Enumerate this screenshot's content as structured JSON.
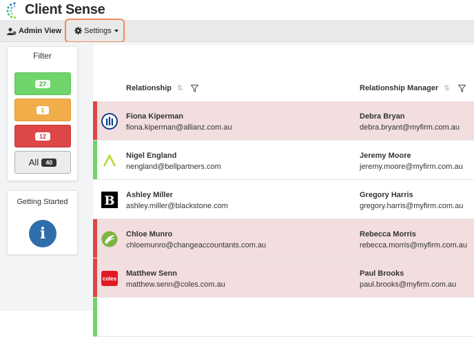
{
  "brand": {
    "name": "Client Sense"
  },
  "nav": {
    "admin_label": "Admin View",
    "settings_label": "Settings"
  },
  "filter": {
    "title": "Filter",
    "green_count": "27",
    "amber_count": "1",
    "red_count": "12",
    "all_label": "All",
    "all_count": "40"
  },
  "getting_started": {
    "title": "Getting Started"
  },
  "table": {
    "headers": {
      "relationship": "Relationship",
      "manager": "Relationship Manager"
    },
    "rows": [
      {
        "name": "Fiona Kiperman",
        "email": "fiona.kiperman@allianz.com.au",
        "manager": "Debra Bryan",
        "manager_email": "debra.bryant@myfirm.com.au",
        "status": "red",
        "logo": "allianz-logo-icon"
      },
      {
        "name": "Nigel England",
        "email": "nengland@bellpartners.com",
        "manager": "Jeremy Moore",
        "manager_email": "jeremy.moore@myfirm.com.au",
        "status": "green",
        "logo": "bell-partners-logo-icon"
      },
      {
        "name": "Ashley Miller",
        "email": "ashley.miller@blackstone.com",
        "manager": "Gregory Harris",
        "manager_email": "gregory.harris@myfirm.com.au",
        "status": "none",
        "logo": "blackstone-logo-icon"
      },
      {
        "name": "Chloe Munro",
        "email": "chloemunro@changeaccountants.com.au",
        "manager": "Rebecca Morris",
        "manager_email": "rebecca.morris@myfirm.com.au",
        "status": "red",
        "logo": "change-accountants-logo-icon"
      },
      {
        "name": "Matthew Senn",
        "email": "matthew.senn@coles.com.au",
        "manager": "Paul Brooks",
        "manager_email": "paul.brooks@myfirm.com.au",
        "status": "red",
        "logo": "coles-logo-icon"
      }
    ],
    "coles_text": "coles"
  },
  "colors": {
    "green": "#6fd56a",
    "amber": "#f1ad49",
    "red": "#dd4747",
    "row_red": "#f2dede",
    "highlight": "#f08a5b",
    "info_blue": "#2f6eaa"
  }
}
